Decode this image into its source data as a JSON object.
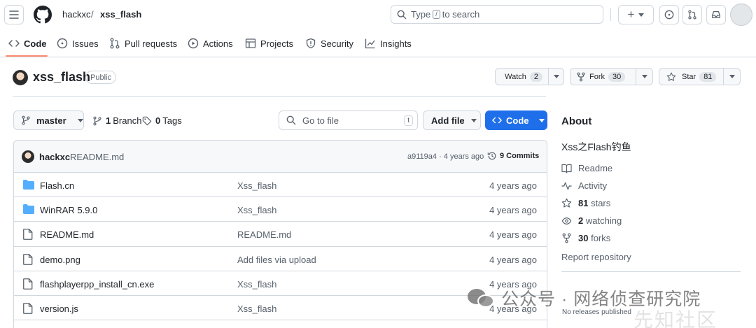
{
  "header": {
    "owner": "hackxc",
    "separator": "/",
    "repo": "xss_flash",
    "search_pre": "Type",
    "search_key": "/",
    "search_post": "to search",
    "plus": "+"
  },
  "tabs": [
    {
      "label": "Code",
      "icon": "code-icon"
    },
    {
      "label": "Issues",
      "icon": "issue-icon"
    },
    {
      "label": "Pull requests",
      "icon": "pull-request-icon"
    },
    {
      "label": "Actions",
      "icon": "play-icon"
    },
    {
      "label": "Projects",
      "icon": "table-icon"
    },
    {
      "label": "Security",
      "icon": "shield-icon"
    },
    {
      "label": "Insights",
      "icon": "graph-icon"
    }
  ],
  "repo": {
    "name": "xss_flash",
    "visibility": "Public",
    "watch_label": "Watch",
    "watch_count": "2",
    "fork_label": "Fork",
    "fork_count": "30",
    "star_label": "Star",
    "star_count": "81"
  },
  "toolbar": {
    "branch": "master",
    "branches_count": "1",
    "branches_label": "Branch",
    "tags_count": "0",
    "tags_label": "Tags",
    "goto_placeholder": "Go to file",
    "goto_key": "t",
    "add_file": "Add file",
    "code": "Code"
  },
  "latest_commit": {
    "user": "hackxc",
    "message": "README.md",
    "hash_time": "a9119a4 · 4 years ago",
    "commits_label": "9 Commits"
  },
  "files": [
    {
      "type": "folder",
      "name": "Flash.cn",
      "message": "Xss_flash",
      "date": "4 years ago"
    },
    {
      "type": "folder",
      "name": "WinRAR 5.9.0",
      "message": "Xss_flash",
      "date": "4 years ago"
    },
    {
      "type": "file",
      "name": "README.md",
      "message": "README.md",
      "date": "4 years ago"
    },
    {
      "type": "file",
      "name": "demo.png",
      "message": "Add files via upload",
      "date": "4 years ago"
    },
    {
      "type": "file",
      "name": "flashplayerpp_install_cn.exe",
      "message": "Xss_flash",
      "date": "4 years ago"
    },
    {
      "type": "file",
      "name": "version.js",
      "message": "Xss_flash",
      "date": "4 years ago"
    }
  ],
  "about": {
    "heading": "About",
    "description": "Xss之Flash钓鱼",
    "readme": "Readme",
    "activity": "Activity",
    "stars_count": "81",
    "stars_label": "stars",
    "watching_count": "2",
    "watching_label": "watching",
    "forks_count": "30",
    "forks_label": "forks",
    "report": "Report repository",
    "releases": "No releases published"
  },
  "watermark": {
    "text": "公众号 · 网络侦查研究院",
    "text2": "先知社区"
  },
  "colors": {
    "accent": "#1f6feb",
    "tab_underline": "#fd8c73",
    "folder": "#54aeff",
    "border": "#d0d7de"
  }
}
